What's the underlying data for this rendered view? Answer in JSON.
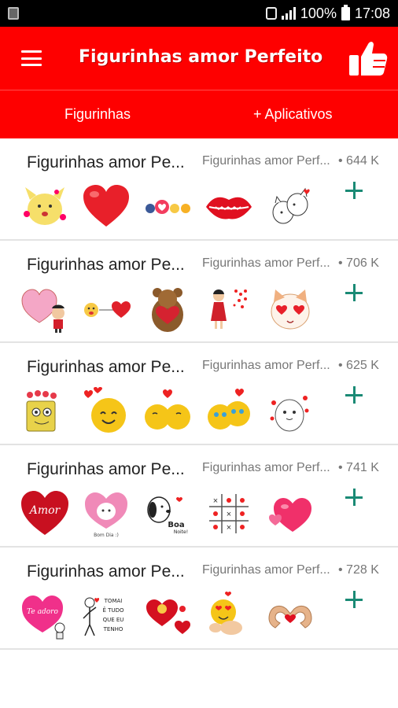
{
  "status_bar": {
    "battery": "100%",
    "time": "17:08"
  },
  "app_bar": {
    "title": "Figurinhas amor Perfeito"
  },
  "tabs": [
    {
      "label": "Figurinhas"
    },
    {
      "label": "+ Aplicativos"
    }
  ],
  "packs": [
    {
      "name": "Figurinhas amor Pe...",
      "author": "Figurinhas amor Perf...",
      "size": "• 644 K",
      "stickers": [
        "pikachu-hearts-sticker",
        "red-heart-sticker",
        "reaction-emojis-sticker",
        "red-lips-sticker",
        "kissing-cats-sticker"
      ]
    },
    {
      "name": "Figurinhas amor Pe...",
      "author": "Figurinhas amor Perf...",
      "size": "• 706 K",
      "stickers": [
        "character-holding-heart-sticker",
        "kiss-emoji-heart-sticker",
        "bears-hugging-sticker",
        "girl-in-red-dress-sticker",
        "cat-heart-eyes-sticker"
      ]
    },
    {
      "name": "Figurinhas amor Pe...",
      "author": "Figurinhas amor Perf...",
      "size": "• 625 K",
      "stickers": [
        "spongebob-hearts-sticker",
        "smiling-emoji-hearts-sticker",
        "emojis-kissing-sticker",
        "heart-eyes-emojis-sticker",
        "cute-character-hearts-sticker"
      ]
    },
    {
      "name": "Figurinhas amor Pe...",
      "author": "Figurinhas amor Perf...",
      "size": "• 741 K",
      "stickers": [
        "amor-heart-sticker",
        "marie-cat-heart-sticker",
        "snoopy-boa-noite-sticker",
        "tic-tac-toe-hearts-sticker",
        "pink-hearts-sticker"
      ]
    },
    {
      "name": "Figurinhas amor Pe...",
      "author": "Figurinhas amor Perf...",
      "size": "• 728 K",
      "stickers": [
        "te-adoro-heart-sticker",
        "tomai-tudo-stick-figure-sticker",
        "red-hearts-cluster-sticker",
        "emoji-heart-hands-sticker",
        "hands-heart-shape-sticker"
      ]
    }
  ],
  "texts": {
    "amor": "Amor",
    "bom_dia": "Bom Dia :)",
    "boa": "Boa",
    "noite": "Noite!",
    "te_adoro": "Te adoro",
    "tomai": "TOMAI",
    "tudo": "Ê TUDO",
    "que_eu": "QUE EU",
    "tenho": "TENHO"
  },
  "colors": {
    "primary": "#fe0000",
    "accent": "#1a8a75",
    "divider": "#e3e3e3"
  }
}
